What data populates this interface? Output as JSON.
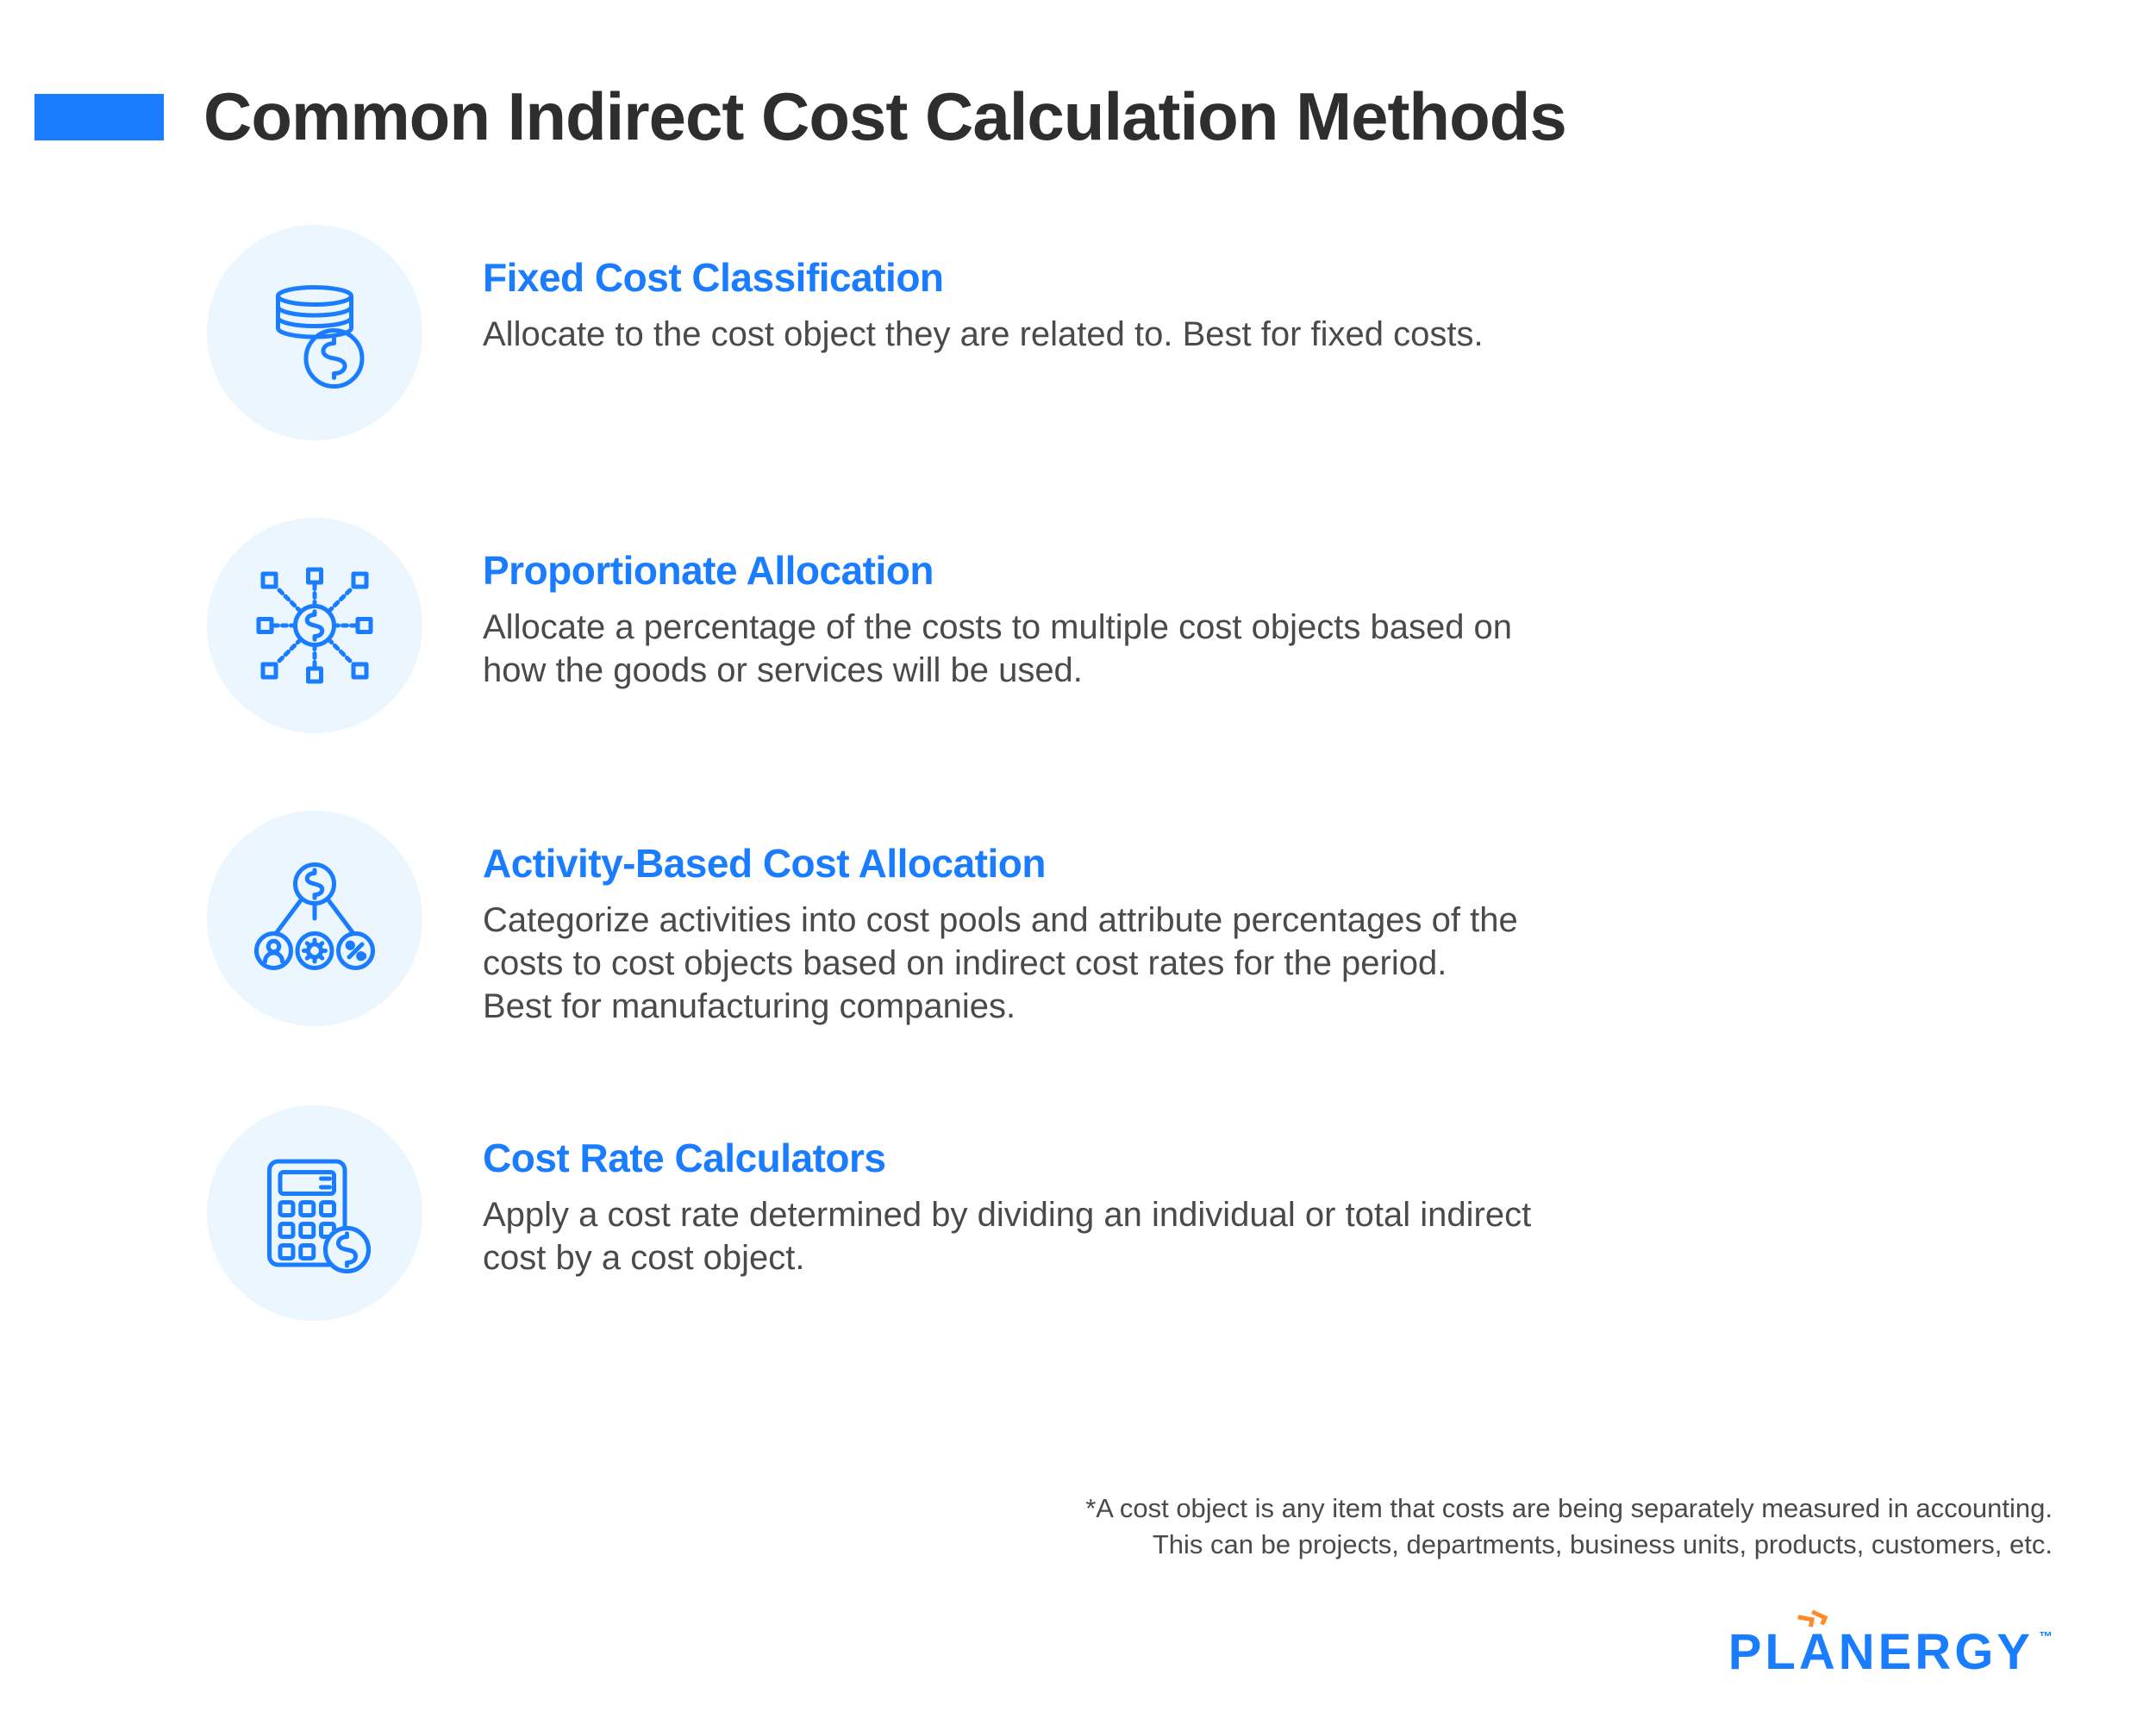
{
  "colors": {
    "accent": "#1a7cff",
    "icon_bg": "#ecf6ff",
    "text": "#3a3a3a",
    "logo_accent": "#ff8a2a"
  },
  "header": {
    "title": "Common Indirect Cost Calculation Methods"
  },
  "methods": [
    {
      "icon": "coins-dollar-icon",
      "title": "Fixed Cost Classification",
      "desc": "Allocate to the cost object they are related to. Best for fixed costs."
    },
    {
      "icon": "distribution-network-icon",
      "title": "Proportionate Allocation",
      "desc": "Allocate a percentage of the costs to multiple cost objects based on\nhow the goods or services will be used."
    },
    {
      "icon": "activity-tree-icon",
      "title": "Activity-Based Cost Allocation",
      "desc": "Categorize activities into cost pools and attribute percentages of the\ncosts to cost objects based on indirect cost rates for the period.\nBest for manufacturing companies."
    },
    {
      "icon": "calculator-dollar-icon",
      "title": "Cost Rate Calculators",
      "desc": "Apply a cost rate determined by dividing an individual or total indirect\ncost by a cost object."
    }
  ],
  "footnote": "*A cost object is any item that costs are being separately measured in accounting.\nThis can be projects, departments, business units, products, customers, etc.",
  "logo": {
    "text": "PLANERGY",
    "tm": "™"
  }
}
